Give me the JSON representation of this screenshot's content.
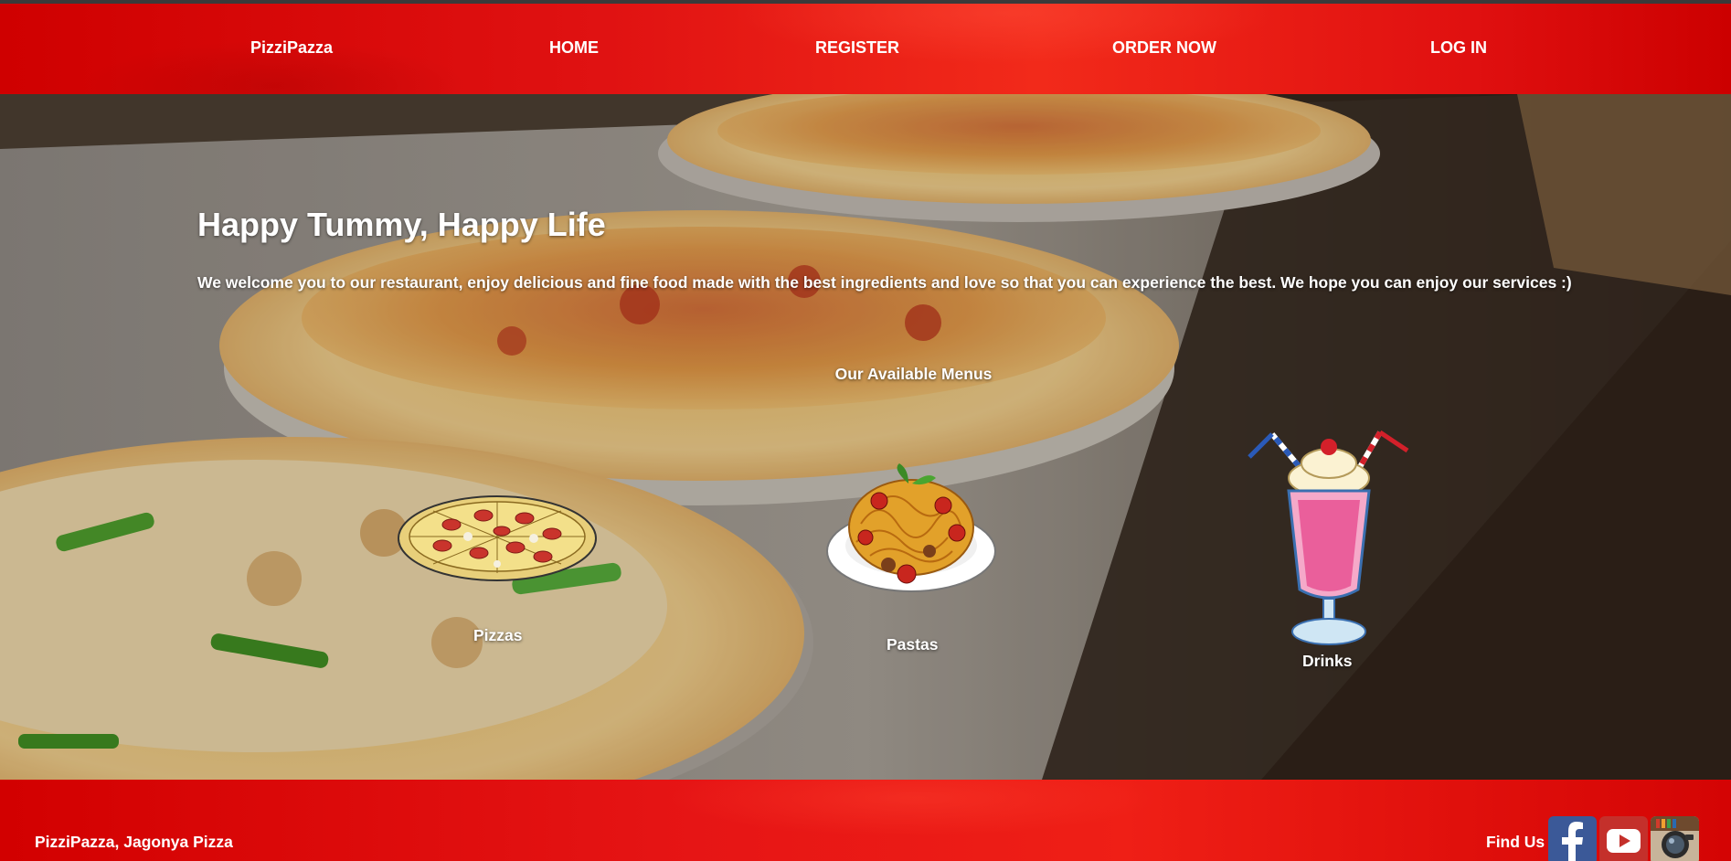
{
  "nav": {
    "brand": "PizziPazza",
    "home": "HOME",
    "register": "REGISTER",
    "order_now": "ORDER NOW",
    "log_in": "LOG IN"
  },
  "hero": {
    "headline": "Happy Tummy, Happy Life",
    "intro": "We welcome you to our restaurant, enjoy delicious and fine food made with the best ingredients and love so that you can experience the best. We hope you can enjoy our services :)",
    "menus_title": "Our Available Menus",
    "menus": [
      {
        "label": "Pizzas",
        "icon": "pizza-icon"
      },
      {
        "label": "Pastas",
        "icon": "pasta-icon"
      },
      {
        "label": "Drinks",
        "icon": "milkshake-icon"
      }
    ]
  },
  "footer": {
    "brand": "PizziPazza, Jagonya Pizza",
    "find_us": "Find Us",
    "socials": [
      "facebook-icon",
      "youtube-icon",
      "instagram-icon"
    ]
  },
  "colors": {
    "nav_red": "#e01212",
    "footer_red": "#e61515",
    "text": "#ffffff"
  }
}
